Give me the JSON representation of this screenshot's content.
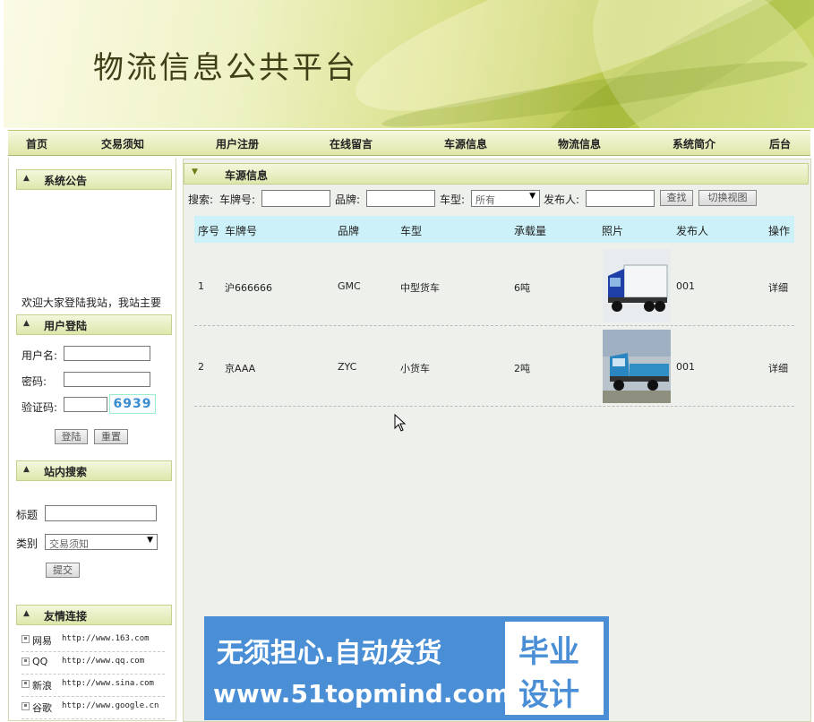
{
  "banner": {
    "title": "物流信息公共平台"
  },
  "nav": {
    "items": [
      "首页",
      "交易须知",
      "用户注册",
      "在线留言",
      "车源信息",
      "物流信息",
      "系统简介",
      "后台"
    ]
  },
  "sidebar": {
    "announcement": {
      "title": "系统公告",
      "text": "欢迎大家登陆我站，我站主要"
    },
    "login": {
      "title": "用户登陆",
      "username_label": "用户名:",
      "password_label": "密码:",
      "captcha_label": "验证码:",
      "captcha_value": "6939",
      "login_button": "登陆",
      "reset_button": "重置"
    },
    "site_search": {
      "title": "站内搜索",
      "title_label": "标题",
      "category_label": "类别",
      "category_selected": "交易须知",
      "submit_button": "提交"
    },
    "links": {
      "title": "友情连接",
      "items": [
        {
          "name": "网易",
          "url": "http://www.163.com"
        },
        {
          "name": "QQ",
          "url": "http://www.qq.com"
        },
        {
          "name": "新浪",
          "url": "http://www.sina.com"
        },
        {
          "name": "谷歌",
          "url": "http://www.google.cn"
        }
      ]
    }
  },
  "main": {
    "title": "车源信息",
    "search": {
      "prefix": "搜索:",
      "plate_label": "车牌号:",
      "brand_label": "品牌:",
      "type_label": "车型:",
      "type_selected": "所有",
      "publisher_label": "发布人:",
      "search_button": "查找",
      "switch_button": "切换视图"
    },
    "table": {
      "headers": [
        "序号",
        "车牌号",
        "品牌",
        "车型",
        "承载量",
        "照片",
        "发布人",
        "操作"
      ],
      "rows": [
        {
          "no": "1",
          "plate": "沪666666",
          "brand": "GMC",
          "type": "中型货车",
          "load": "6吨",
          "publisher": "001",
          "action": "详细"
        },
        {
          "no": "2",
          "plate": "京AAA",
          "brand": "ZYC",
          "type": "小货车",
          "load": "2吨",
          "publisher": "001",
          "action": "详细"
        }
      ]
    }
  },
  "watermark": {
    "line1": "无须担心.自动发货",
    "line2": "www.51topmind.com",
    "right1": "毕业",
    "right2": "设计"
  }
}
